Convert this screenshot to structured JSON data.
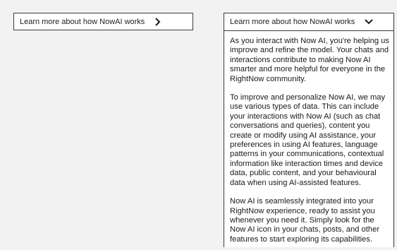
{
  "left_panel": {
    "title": "Learn more about how NowAI works",
    "chevron_icon": "chevron-right-icon"
  },
  "right_panel": {
    "title": "Learn more about how NowAI works",
    "chevron_icon": "chevron-down-icon",
    "paragraphs": [
      "As you interact with Now AI, you're helping us improve and refine the model. Your chats and interactions contribute to making Now AI smarter and more helpful for everyone in the RightNow community.",
      "To improve and personalize Now AI, we may use various types of data. This can include your interactions with Now AI (such as chat conversations and queries), content you create or modify using AI assistance, your preferences in  using AI features, language patterns in your communications, contextual information like interaction times and device data, public content, and your behavioural data when using AI-assisted features.",
      "Now AI is seamlessly integrated into your RightNow experience, ready to assist you whenever you need it. Simply look for the Now AI icon in your chats, posts, and other features to start exploring its capabilities."
    ]
  }
}
